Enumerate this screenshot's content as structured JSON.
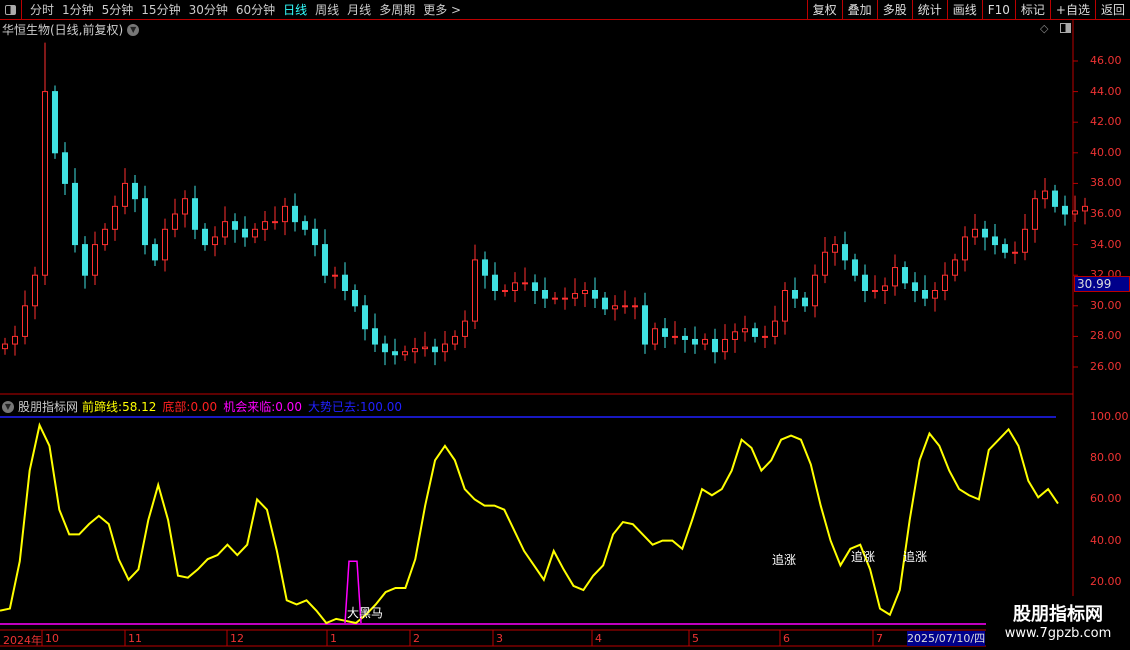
{
  "toolbar": {
    "periods": [
      "分时",
      "1分钟",
      "5分钟",
      "15分钟",
      "30分钟",
      "60分钟",
      "日线",
      "周线",
      "月线",
      "多周期",
      "更多 >"
    ],
    "active": "日线",
    "buttons": [
      "复权",
      "叠加",
      "多股",
      "统计",
      "画线",
      "F10",
      "标记",
      "+自选",
      "返回"
    ]
  },
  "title": "华恒生物(日线,前复权)",
  "price_axis": [
    "46.00",
    "44.00",
    "42.00",
    "40.00",
    "38.00",
    "36.00",
    "34.00",
    "32.00",
    "30.00",
    "28.00",
    "26.00"
  ],
  "current_price": "30.99",
  "indicator": {
    "name": "股朋指标网",
    "items": [
      {
        "label": "前蹄线:",
        "value": "58.12",
        "color": "#ffff00"
      },
      {
        "label": "底部:",
        "value": "0.00",
        "color": "#ff2020"
      },
      {
        "label": "机会来临:",
        "value": "0.00",
        "color": "#ff00ff"
      },
      {
        "label": "大势已去:",
        "value": "100.00",
        "color": "#2020ff"
      }
    ],
    "axis": [
      "100.00",
      "80.00",
      "60.00",
      "40.00",
      "20.00"
    ],
    "annotations": [
      "追涨",
      "追涨",
      "追涨",
      "大黑马"
    ]
  },
  "date_axis": [
    "2024年",
    "10",
    "11",
    "12",
    "1",
    "2",
    "3",
    "4",
    "5",
    "6",
    "7"
  ],
  "date_cursor": "2025/07/10/四",
  "watermark": {
    "line1": "股朋指标网",
    "line2": "www.7gpzb.com"
  },
  "chart_data": [
    {
      "type": "candlestick",
      "title": "华恒生物(日线,前复权)",
      "ylim": [
        25,
        47
      ],
      "closes": [
        27.5,
        28,
        30,
        32,
        44,
        40,
        38,
        34,
        32,
        34,
        35,
        36.5,
        38,
        37,
        34,
        33,
        35,
        36,
        37,
        35,
        34,
        34.5,
        35.5,
        35,
        34.5,
        35,
        35.5,
        35.5,
        36.5,
        35.5,
        35,
        34,
        32,
        32,
        31,
        30,
        28.5,
        27.5,
        27,
        26.8,
        27,
        27.2,
        27.3,
        27,
        27.5,
        28,
        29,
        33,
        32,
        31,
        31,
        31.5,
        31.5,
        31,
        30.5,
        30.5,
        30.5,
        30.8,
        31,
        30.5,
        29.8,
        30,
        30,
        30,
        27.5,
        28.5,
        28,
        28,
        27.8,
        27.5,
        27.8,
        27,
        27.8,
        28.3,
        28.5,
        28,
        28,
        29,
        31,
        30.5,
        30,
        32,
        33.5,
        34,
        33,
        32,
        31,
        31,
        31.3,
        32.5,
        31.5,
        31,
        30.5,
        31,
        32,
        33,
        34.5,
        35,
        34.5,
        34,
        33.5,
        33.5,
        35,
        37,
        37.5,
        36.5,
        36,
        36.2,
        36.5
      ]
    },
    {
      "type": "line",
      "title": "股朋指标网",
      "ylim": [
        0,
        100
      ],
      "series": [
        {
          "name": "前蹄线",
          "values": [
            6,
            7,
            30,
            74,
            96,
            86,
            55,
            43,
            43,
            48,
            52,
            48,
            31,
            21,
            26,
            50,
            67,
            50,
            23,
            22,
            26,
            31,
            33,
            38,
            33,
            38,
            60,
            55,
            35,
            11,
            9,
            11,
            6,
            0,
            2,
            1,
            0,
            4,
            9,
            15,
            17,
            17,
            31,
            57,
            79,
            86,
            79,
            65,
            60,
            57,
            57,
            55,
            45,
            35,
            28,
            21,
            35,
            26,
            18,
            16,
            23,
            28,
            43,
            49,
            48,
            43,
            38,
            40,
            40,
            36,
            50,
            65,
            62,
            65,
            74,
            89,
            85,
            74,
            79,
            89,
            91,
            89,
            77,
            57,
            40,
            28,
            36,
            38,
            26,
            7,
            4,
            16,
            50,
            79,
            92,
            86,
            74,
            65,
            62,
            60,
            84,
            89,
            94,
            86,
            69,
            61,
            65,
            58
          ]
        },
        {
          "name": "机会来临",
          "values": [
            0,
            30,
            30,
            0
          ]
        },
        {
          "name": "底部",
          "values": [
            0
          ]
        },
        {
          "name": "大势已去",
          "values": [
            100
          ]
        }
      ]
    }
  ]
}
